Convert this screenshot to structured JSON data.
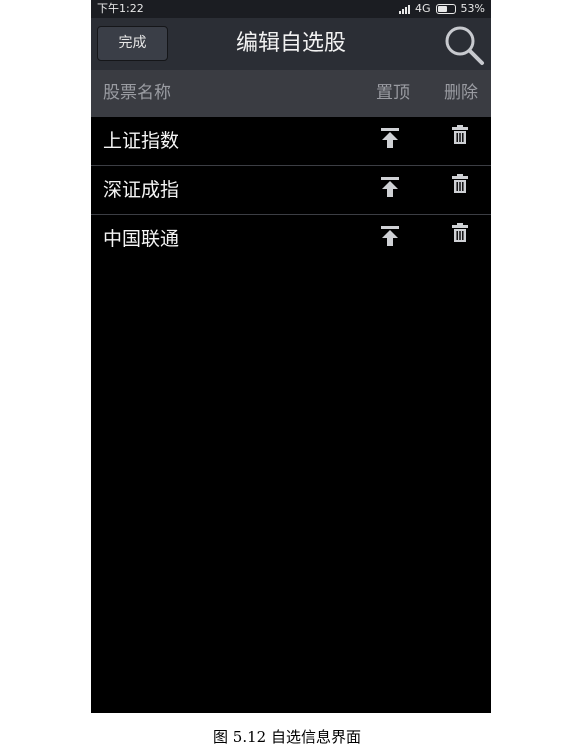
{
  "status_bar": {
    "time": "下午1:22",
    "network": "4G",
    "battery": "53%"
  },
  "nav": {
    "done_label": "完成",
    "title": "编辑自选股"
  },
  "columns": {
    "name": "股票名称",
    "top": "置顶",
    "delete": "删除"
  },
  "stocks": [
    {
      "name": "上证指数"
    },
    {
      "name": "深证成指"
    },
    {
      "name": "中国联通"
    }
  ],
  "caption": "图 5.12 自选信息界面",
  "colors": {
    "nav_bg": "#2b2e35",
    "header_bg": "#3a3c42",
    "list_bg": "#000000",
    "text": "#f5f5f5"
  },
  "icons": {
    "search": "search-icon",
    "pin_top": "pin-to-top-icon",
    "delete": "trash-icon"
  }
}
